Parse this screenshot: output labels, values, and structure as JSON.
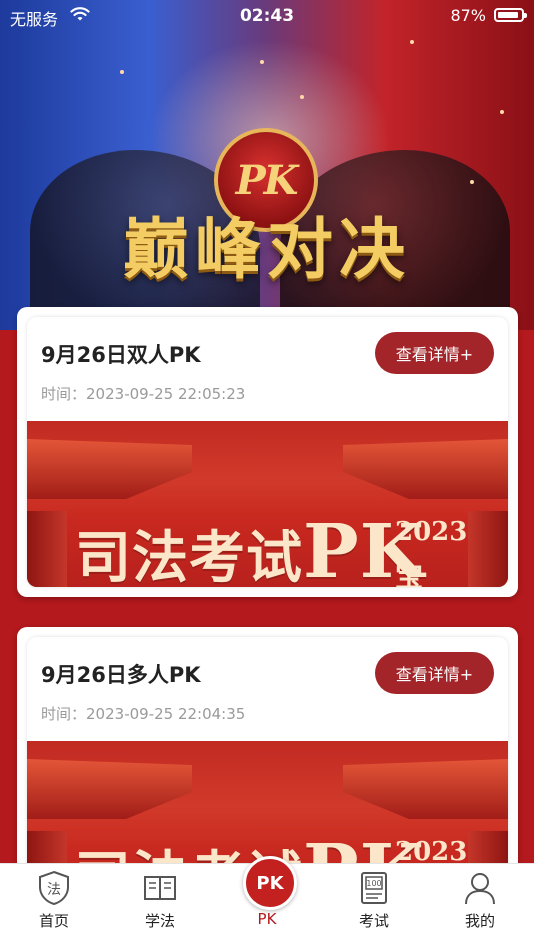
{
  "status_bar": {
    "carrier": "无服务",
    "time": "02:43",
    "battery": "87%"
  },
  "hero": {
    "badge_text": "PK",
    "title": "巅峰对决"
  },
  "cards": [
    {
      "title": "9月26日双人PK",
      "time_label": "时间：",
      "time_value": "2023-09-25 22:05:23",
      "button_label": "查看详情+",
      "banner": {
        "text": "司法考试",
        "big": "PK",
        "year": "2023",
        "more": "宝"
      }
    },
    {
      "title": "9月26日多人PK",
      "time_label": "时间：",
      "time_value": "2023-09-25 22:04:35",
      "button_label": "查看详情+",
      "banner": {
        "text": "司法考试",
        "big": "PK",
        "year": "2023",
        "more": ""
      }
    }
  ],
  "tabbar": {
    "items": [
      {
        "label": "首页",
        "icon": "law-shield-icon"
      },
      {
        "label": "学法",
        "icon": "book-icon"
      },
      {
        "label": "PK",
        "icon": "pk-icon",
        "active": true
      },
      {
        "label": "考试",
        "icon": "exam-score-icon"
      },
      {
        "label": "我的",
        "icon": "user-icon"
      }
    ],
    "home_icon_char": "法",
    "exam_icon_text": "100",
    "pk_icon_text": "PK"
  }
}
